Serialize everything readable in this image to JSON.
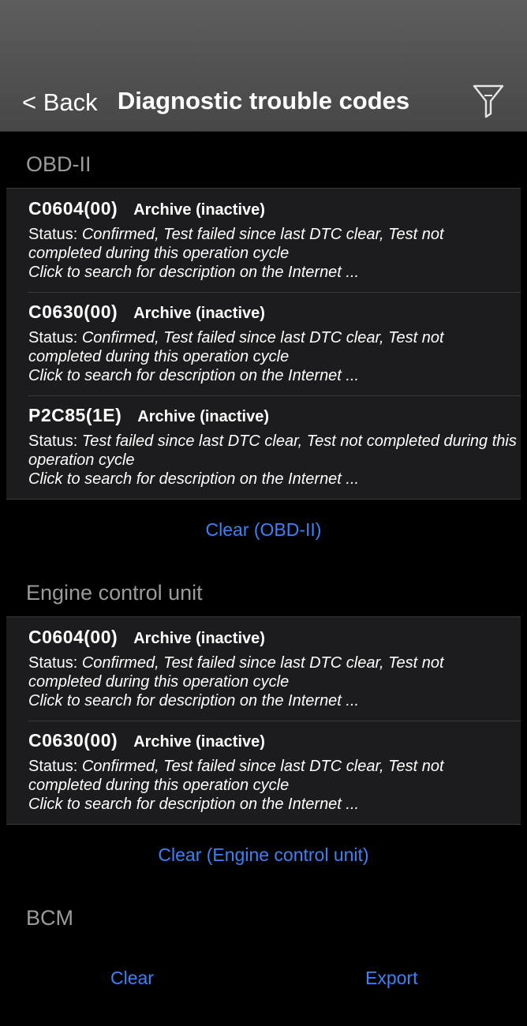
{
  "nav": {
    "back_label": "< Back",
    "title": "Diagnostic trouble codes",
    "filter_icon": "funnel-icon"
  },
  "sections": [
    {
      "title": "OBD-II",
      "items": [
        {
          "code": "C0604(00)",
          "state": "Archive (inactive)",
          "status_label": "Status: ",
          "status_value": "Confirmed, Test failed since last DTC clear, Test not completed during this operation cycle",
          "hint": "Click to search for description on the Internet ..."
        },
        {
          "code": "C0630(00)",
          "state": "Archive (inactive)",
          "status_label": "Status: ",
          "status_value": "Confirmed, Test failed since last DTC clear, Test not completed during this operation cycle",
          "hint": "Click to search for description on the Internet ..."
        },
        {
          "code": "P2C85(1E)",
          "state": "Archive (inactive)",
          "status_label": "Status: ",
          "status_value": "Test failed since last DTC clear, Test not completed during this operation cycle",
          "hint": "Click to search for description on the Internet ..."
        }
      ],
      "clear_label": "Clear (OBD-II)"
    },
    {
      "title": "Engine control unit",
      "items": [
        {
          "code": "C0604(00)",
          "state": "Archive (inactive)",
          "status_label": "Status: ",
          "status_value": "Confirmed, Test failed since last DTC clear, Test not completed during this operation cycle",
          "hint": "Click to search for description on the Internet ..."
        },
        {
          "code": "C0630(00)",
          "state": "Archive (inactive)",
          "status_label": "Status: ",
          "status_value": "Confirmed, Test failed since last DTC clear, Test not completed during this operation cycle",
          "hint": "Click to search for description on the Internet ..."
        }
      ],
      "clear_label": "Clear (Engine control unit)"
    },
    {
      "title": "BCM"
    }
  ],
  "toolbar": {
    "clear_label": "Clear",
    "export_label": "Export"
  },
  "colors": {
    "accent": "#3b82f6",
    "navbar": "#5e5e5e",
    "cell": "#1c1c1e",
    "section_header": "#9b9b9b"
  }
}
